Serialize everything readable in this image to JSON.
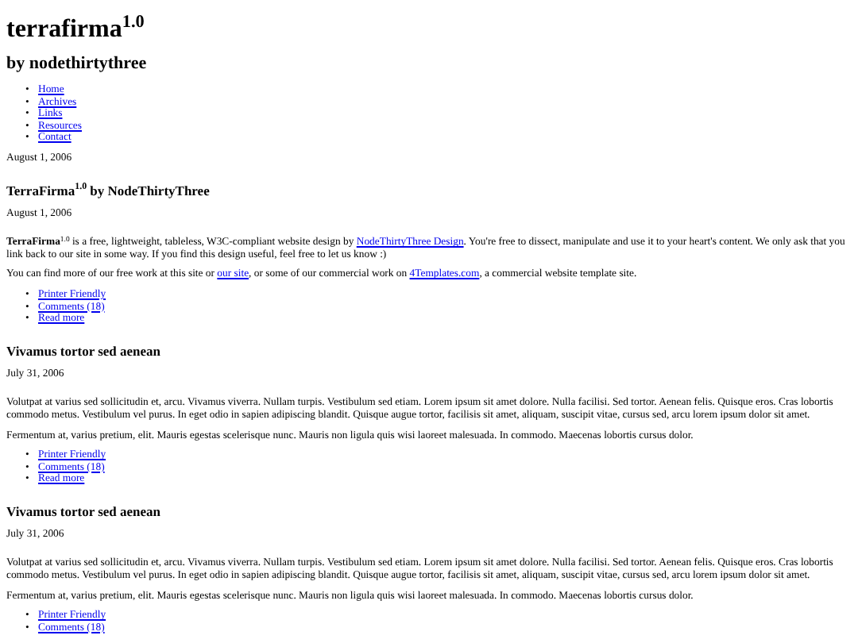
{
  "bullet": "•",
  "header": {
    "title": "terrafirma$^{1.0}$",
    "subtitle": "by nodethirtythree"
  },
  "nav": [
    {
      "label": "Home"
    },
    {
      "label": "Archives"
    },
    {
      "label": "Links"
    },
    {
      "label": "Resources"
    },
    {
      "label": "Contact"
    }
  ],
  "date": "August 1, 2006",
  "posts": [
    {
      "title": "TerraFirma$^{1.0}$ by NodeThirtyThree",
      "date": "August 1, 2006",
      "paragraphs": [
        [
          {
            "kind": "text",
            "text": "**TerraFirma**$^{1.0}$ is a free, lightweight, tableless, W3C-compliant website design by "
          },
          {
            "kind": "link",
            "text": "NodeThirtyThree Design"
          },
          {
            "kind": "text",
            "text": ". You're free to dissect, manipulate and use it to your heart's content. We only ask that you link back to our site in some way. If you find this design useful, feel free to let us know :)"
          }
        ],
        [
          {
            "kind": "text",
            "text": "You can find more of our free work at this site or "
          },
          {
            "kind": "link",
            "text": "our site"
          },
          {
            "kind": "text",
            "text": ", or some of our commercial work on "
          },
          {
            "kind": "link",
            "text": "4Templates.com"
          },
          {
            "kind": "text",
            "text": ", a commercial website template site."
          }
        ]
      ],
      "links": [
        "Printer Friendly",
        "Comments (18)",
        "Read more"
      ]
    },
    {
      "title": "Vivamus tortor sed aenean",
      "date": "July 31, 2006",
      "paragraphs": [
        [
          {
            "kind": "text",
            "text": "Volutpat at varius sed sollicitudin et, arcu. Vivamus viverra. Nullam turpis. Vestibulum sed etiam. Lorem ipsum sit amet dolore. Nulla facilisi. Sed tortor. Aenean felis. Quisque eros. Cras lobortis commodo metus. Vestibulum vel purus. In eget odio in sapien adipiscing blandit. Quisque augue tortor, facilisis sit amet, aliquam, suscipit vitae, cursus sed, arcu lorem ipsum dolor sit amet."
          }
        ],
        [
          {
            "kind": "text",
            "text": "Fermentum at, varius pretium, elit. Mauris egestas scelerisque nunc. Mauris non ligula quis wisi laoreet malesuada. In commodo. Maecenas lobortis cursus dolor."
          }
        ]
      ],
      "links": [
        "Printer Friendly",
        "Comments (18)",
        "Read more"
      ]
    },
    {
      "title": "Vivamus tortor sed aenean",
      "date": "July 31, 2006",
      "paragraphs": [
        [
          {
            "kind": "text",
            "text": "Volutpat at varius sed sollicitudin et, arcu. Vivamus viverra. Nullam turpis. Vestibulum sed etiam. Lorem ipsum sit amet dolore. Nulla facilisi. Sed tortor. Aenean felis. Quisque eros. Cras lobortis commodo metus. Vestibulum vel purus. In eget odio in sapien adipiscing blandit. Quisque augue tortor, facilisis sit amet, aliquam, suscipit vitae, cursus sed, arcu lorem ipsum dolor sit amet."
          }
        ],
        [
          {
            "kind": "text",
            "text": "Fermentum at, varius pretium, elit. Mauris egestas scelerisque nunc. Mauris non ligula quis wisi laoreet malesuada. In commodo. Maecenas lobortis cursus dolor."
          }
        ]
      ],
      "links": [
        "Printer Friendly",
        "Comments (18)"
      ]
    }
  ]
}
